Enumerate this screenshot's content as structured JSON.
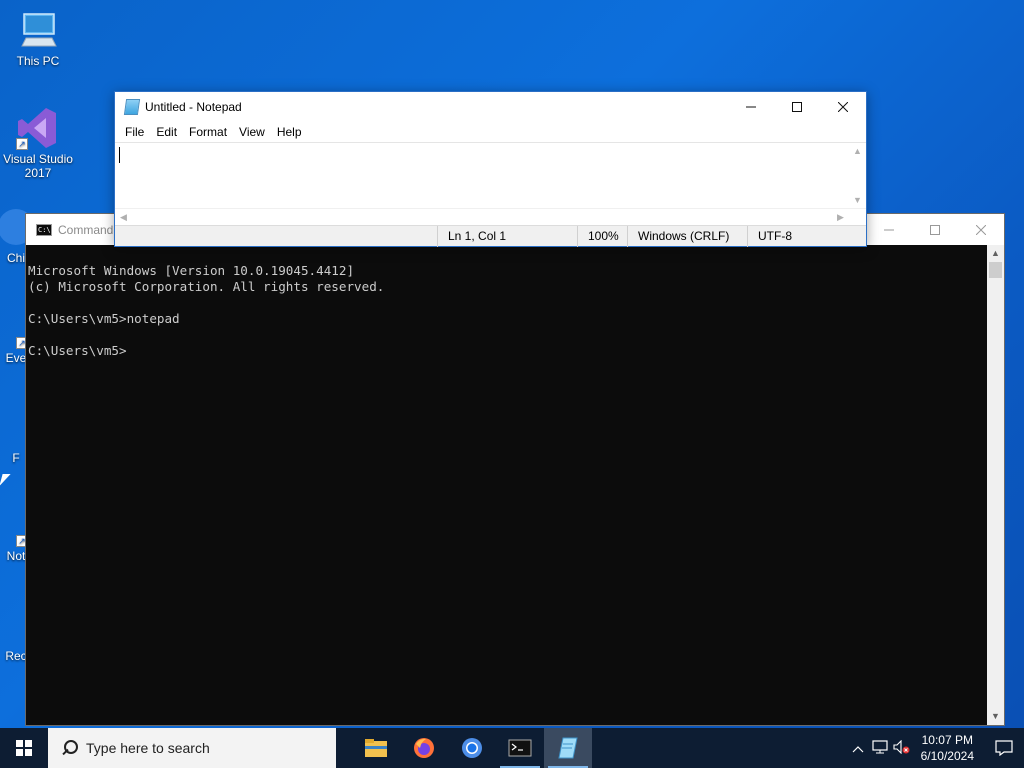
{
  "desktop": {
    "icons": [
      {
        "label": "This PC"
      },
      {
        "label": "Visual Studio 2017"
      },
      {
        "label": "Chi"
      },
      {
        "label": "Eve"
      },
      {
        "label": "F"
      },
      {
        "label": "Not"
      },
      {
        "label": "Rec"
      }
    ]
  },
  "cmd": {
    "title": "Command",
    "lines": [
      "Microsoft Windows [Version 10.0.19045.4412]",
      "(c) Microsoft Corporation. All rights reserved.",
      "",
      "C:\\Users\\vm5>notepad",
      "",
      "C:\\Users\\vm5>"
    ]
  },
  "notepad": {
    "title": "Untitled - Notepad",
    "menu": [
      "File",
      "Edit",
      "Format",
      "View",
      "Help"
    ],
    "status": {
      "position": "Ln 1, Col 1",
      "zoom": "100%",
      "line_ending": "Windows (CRLF)",
      "encoding": "UTF-8"
    }
  },
  "taskbar": {
    "search_placeholder": "Type here to search",
    "apps": [
      "file-explorer",
      "firefox",
      "chrome",
      "command-prompt",
      "notepad"
    ],
    "clock_time": "10:07 PM",
    "clock_date": "6/10/2024"
  },
  "colors": {
    "desktop": "#0b63c9",
    "taskbar": "#0d1d33",
    "console_bg": "#0c0c0c",
    "console_text": "#cccccc"
  }
}
